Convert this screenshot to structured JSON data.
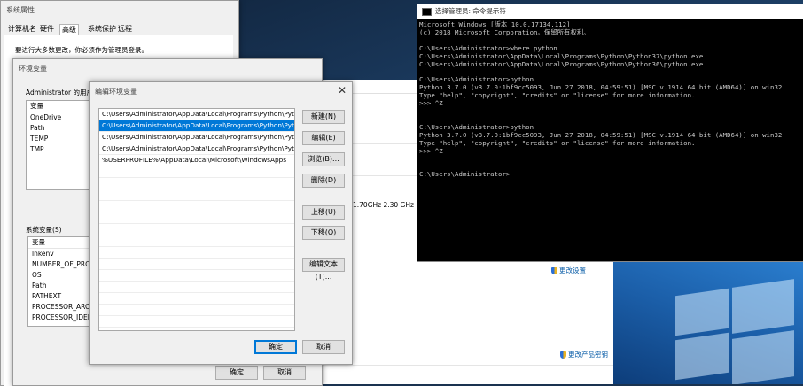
{
  "sysprops": {
    "title": "系统属性",
    "tabs": [
      "计算机名",
      "硬件",
      "高级",
      "系统保护",
      "远程"
    ],
    "note": "要进行大多数更改，你必须作为管理员登录。"
  },
  "envvars": {
    "title": "环境变量",
    "user_label": "Administrator 的用户变量",
    "user_header": "变量",
    "user_rows": [
      "OneDrive",
      "Path",
      "TEMP",
      "TMP"
    ],
    "sys_label": "系统变量(S)",
    "sys_header": "变量",
    "sys_rows": [
      "lnkenv",
      "NUMBER_OF_PROCE",
      "OS",
      "Path",
      "PATHEXT",
      "PROCESSOR_ARCHI",
      "PROCESSOR_IDENT"
    ],
    "ok": "确定",
    "cancel": "取消"
  },
  "editenv": {
    "title": "编辑环境变量",
    "close": "✕",
    "items": [
      "C:\\Users\\Administrator\\AppData\\Local\\Programs\\Python\\Pytho...",
      "C:\\Users\\Administrator\\AppData\\Local\\Programs\\Python\\Pytho...",
      "C:\\Users\\Administrator\\AppData\\Local\\Programs\\Python\\Pytho...",
      "C:\\Users\\Administrator\\AppData\\Local\\Programs\\Python\\Pytho...",
      "%USERPROFILE%\\AppData\\Local\\Microsoft\\WindowsApps"
    ],
    "selected_index": 1,
    "buttons": {
      "new": "新建(N)",
      "edit": "编辑(E)",
      "browse": "浏览(B)...",
      "delete": "删除(D)",
      "up": "上移(U)",
      "down": "下移(O)",
      "edit_text": "编辑文本(T)...",
      "ok": "确定",
      "cancel": "取消"
    }
  },
  "background_window": {
    "cpu_speed": "1.70GHz   2.30 GHz",
    "change_settings": "更改设置",
    "change_key": "更改产品密钥"
  },
  "console": {
    "title": "选择管理员: 命令提示符",
    "lines": [
      "Microsoft Windows [版本 10.0.17134.112]",
      "(c) 2018 Microsoft Corporation。保留所有权利。",
      "",
      "C:\\Users\\Administrator>where python",
      "C:\\Users\\Administrator\\AppData\\Local\\Programs\\Python\\Python37\\python.exe",
      "C:\\Users\\Administrator\\AppData\\Local\\Programs\\Python\\Python36\\python.exe",
      "",
      "C:\\Users\\Administrator>python",
      "Python 3.7.0 (v3.7.0:1bf9cc5093, Jun 27 2018, 04:59:51) [MSC v.1914 64 bit (AMD64)] on win32",
      "Type \"help\", \"copyright\", \"credits\" or \"license\" for more information.",
      ">>> ^Z",
      "",
      "",
      "C:\\Users\\Administrator>python",
      "Python 3.7.0 (v3.7.0:1bf9cc5093, Jun 27 2018, 04:59:51) [MSC v.1914 64 bit (AMD64)] on win32",
      "Type \"help\", \"copyright\", \"credits\" or \"license\" for more information.",
      ">>> ^Z",
      "",
      "",
      "C:\\Users\\Administrator>"
    ]
  },
  "colors": {
    "accent": "#0078d7",
    "console_bg": "#000000",
    "console_fg": "#c8c8c8"
  }
}
